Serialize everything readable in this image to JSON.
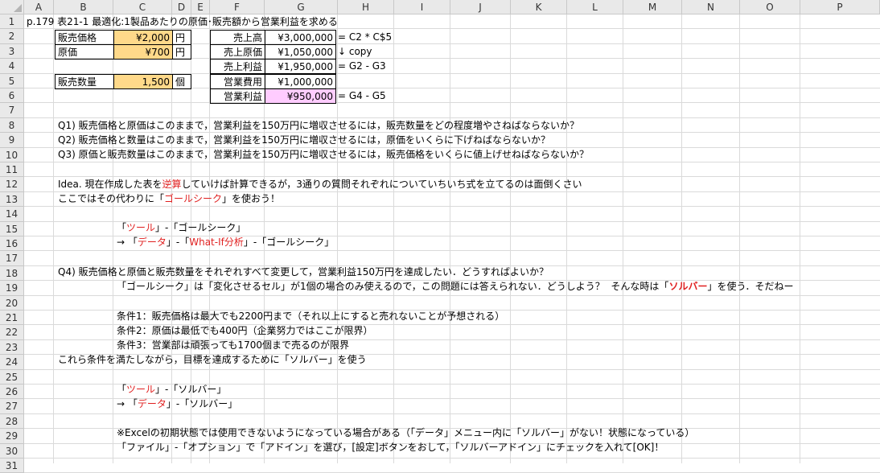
{
  "columns": [
    "A",
    "B",
    "C",
    "D",
    "E",
    "F",
    "G",
    "H",
    "I",
    "J",
    "K",
    "L",
    "M",
    "N",
    "O",
    "P"
  ],
  "rows": [
    "1",
    "2",
    "3",
    "4",
    "5",
    "6",
    "7",
    "8",
    "9",
    "10",
    "11",
    "12",
    "13",
    "14",
    "15",
    "16",
    "17",
    "18",
    "19",
    "20",
    "21",
    "22",
    "23",
    "24",
    "25",
    "26",
    "27",
    "28",
    "29",
    "30",
    "31"
  ],
  "title": "p.179 表21-1 最適化:1製品あたりの原価･販売額から営業利益を求める",
  "inputs": {
    "price_label": "販売価格",
    "price_value": "¥2,000",
    "price_unit": "円",
    "cost_label": "原価",
    "cost_value": "¥700",
    "cost_unit": "円",
    "qty_label": "販売数量",
    "qty_value": "1,500",
    "qty_unit": "個"
  },
  "pl": {
    "sales_label": "売上高",
    "sales_value": "¥3,000,000",
    "sales_formula": "= C2 * C$5",
    "cogs_label": "売上原価",
    "cogs_value": "¥1,050,000",
    "cogs_formula": "↓ copy",
    "gross_label": "売上利益",
    "gross_value": "¥1,950,000",
    "gross_formula": "= G2 - G3",
    "opex_label": "営業費用",
    "opex_value": "¥1,000,000",
    "profit_label": "営業利益",
    "profit_value": "¥950,000",
    "profit_formula": "= G4 - G5"
  },
  "q": {
    "q1": "Q1)  販売価格と原価はこのままで，営業利益を150万円に増収させるには，販売数量をどの程度増やさねばならないか？",
    "q2": "Q2)  販売価格と数量はこのままで，営業利益を150万円に増収させるには，原価をいくらに下げねばならないか？",
    "q3": "Q3)  原価と販売数量はこのままで，営業利益を150万円に増収させるには，販売価格をいくらに値上げせねばならないか？"
  },
  "idea": {
    "a": "Idea. 現在作成した表を",
    "b": "逆算",
    "c": "していけば計算できるが，3通りの質問それぞれについていちいち式を立てるのは面倒くさい"
  },
  "r13": {
    "a": "ここではその代わりに「",
    "b": "ゴールシーク",
    "c": "」を使おう！"
  },
  "r15": {
    "a": "「",
    "b": "ツール",
    "c": "」-「ゴールシーク」"
  },
  "r16": {
    "a": "→ 「",
    "b": "データ",
    "c": "」-「",
    "d": "What-If分析",
    "e": "」-「ゴールシーク」"
  },
  "r18": "Q4)  販売価格と原価と販売数量をそれぞれすべて変更して，営業利益150万円を達成したい．どうすればよいか？",
  "r19": {
    "a": "「ゴールシーク」は「変化させるセル」が1個の場合のみ使えるので，この問題には答えられない．どうしよう？  そんな時は「",
    "b": "ソルバー",
    "c": "」を使う．そだねー"
  },
  "cond1": "条件1：販売価格は最大でも2200円まで（それ以上にすると売れないことが予想される）",
  "cond2": "条件2：原価は最低でも400円（企業努力ではここが限界）",
  "cond3": "条件3：営業部は頑張っても1700個まで売るのが限界",
  "r24": "これら条件を満たしながら，目標を達成するために「ソルバー」を使う",
  "r26": {
    "a": "「",
    "b": "ツール",
    "c": "」-「ソルバー」"
  },
  "r27": {
    "a": "→ 「",
    "b": "データ",
    "c": "」-「ソルバー」"
  },
  "r29": "※Excelの初期状態では使用できないようになっている場合がある（「データ」メニュー内に「ソルバー」がない！状態になっている）",
  "r30": "「ファイル」-「オプション」で「アドイン」を選び，[設定]ボタンをおして，「ソルバーアドイン」にチェックを入れて[OK]！",
  "colors": {
    "input_fill": "#ffd98a",
    "result_fill": "#ffccff",
    "formula_green": "#4d8a28",
    "highlight_red": "#e02020",
    "title_blue": "#1a62b0"
  }
}
